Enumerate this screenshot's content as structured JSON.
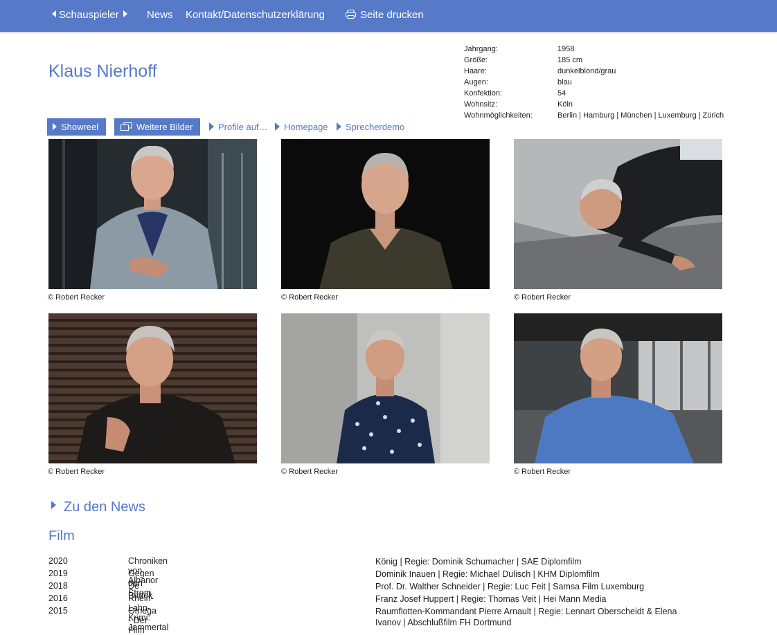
{
  "nav": {
    "schauspieler": "Schauspieler",
    "news": "News",
    "kontakt": "Kontakt/Datenschutzerklärung",
    "print": "Seite drucken"
  },
  "actor": {
    "name": "Klaus Nierhoff"
  },
  "facts": [
    {
      "label": "Jahrgang:",
      "value": "1958"
    },
    {
      "label": "Größe:",
      "value": "185 cm"
    },
    {
      "label": "Haare:",
      "value": "dunkelblond/grau"
    },
    {
      "label": "Augen:",
      "value": "blau"
    },
    {
      "label": "Konfektion:",
      "value": "54"
    },
    {
      "label": "Wohnsitz:",
      "value": "Köln"
    },
    {
      "label": "Wohnmöglichkeiten:",
      "value": "Berlin | Hamburg | München | Luxemburg | Zürich"
    }
  ],
  "actions": {
    "showreel": "Showreel",
    "weitere": "Weitere Bilder",
    "profile": "Profile auf…",
    "homepage": "Homepage",
    "sprecherdemo": "Sprecherdemo"
  },
  "photos": [
    {
      "credit": "© Robert Recker"
    },
    {
      "credit": "© Robert Recker"
    },
    {
      "credit": "© Robert Recker"
    },
    {
      "credit": "© Robert Recker"
    },
    {
      "credit": "© Robert Recker"
    },
    {
      "credit": "© Robert Recker"
    }
  ],
  "news_link": "Zu den News",
  "film": {
    "heading": "Film",
    "rows": [
      {
        "year": "2020",
        "title": "Chroniken von Albanor",
        "details": "König | Regie: Dominik Schumacher | SAE Diplomfilm"
      },
      {
        "year": "2019",
        "title": "Gegen den Strom",
        "details": "Dominik Inauen | Regie: Michael Dulisch | KHM Diplomfilm"
      },
      {
        "year": "2018",
        "title": "De Buttek",
        "details": "Prof. Dr. Walther Schneider | Regie: Luc Feit | Samsa Film Luxemburg"
      },
      {
        "year": "2016",
        "title": "Rhein-Lahn-Krimi: Jammertal",
        "details": "Franz Josef Huppert | Regie: Thomas Veit | Hei Mann Media"
      },
      {
        "year": "2015",
        "title": "Omega - Der Film",
        "details": "Raumflotten-Kommandant Pierre Arnault | Regie: Lennart Oberscheidt & Elena Ivanov | Abschlußfilm FH Dortmund"
      }
    ]
  },
  "colors": {
    "brand": "#5679c8"
  }
}
